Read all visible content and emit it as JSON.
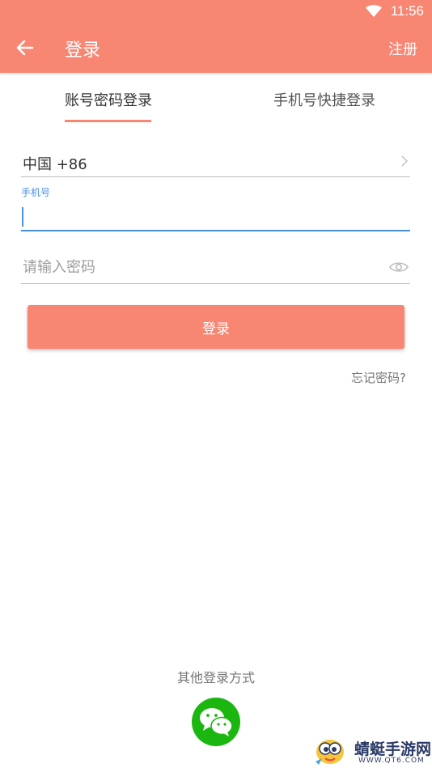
{
  "status_bar": {
    "time": "11:56"
  },
  "app_bar": {
    "title": "登录",
    "register_label": "注册"
  },
  "tabs": [
    {
      "label": "账号密码登录",
      "active": true
    },
    {
      "label": "手机号快捷登录",
      "active": false
    }
  ],
  "form": {
    "country_code": "中国 +86",
    "phone_label": "手机号",
    "phone_value": "",
    "password_placeholder": "请输入密码",
    "login_button": "登录",
    "forgot_password": "忘记密码?"
  },
  "other_login": {
    "label": "其他登录方式",
    "icon": "wechat-icon"
  },
  "watermark": {
    "name": "蜻蜓手游网",
    "url": "WWW.QT6.COM"
  },
  "colors": {
    "accent": "#f78673",
    "focus_blue": "#4a90e2",
    "wechat_green": "#1bb60f"
  }
}
